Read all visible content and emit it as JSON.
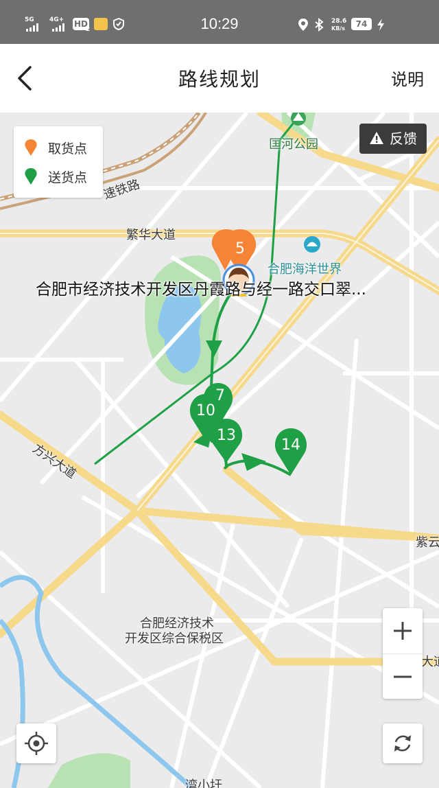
{
  "status_bar": {
    "network1": "5G",
    "network2": "4G+",
    "hd": "HD",
    "hd_sub": "2",
    "time": "10:29",
    "speed_value": "28.6",
    "speed_unit": "KB/s",
    "battery": "74"
  },
  "header": {
    "title": "路线规划",
    "help_label": "说明",
    "back_icon": "chevron-left-icon"
  },
  "map": {
    "legend": [
      {
        "label": "取货点",
        "color": "#F58434"
      },
      {
        "label": "送货点",
        "color": "#1FA046"
      }
    ],
    "feedback_label": "反馈",
    "address_label": "合肥市经济技术开发区丹霞路与经一路交口翠...",
    "labels": {
      "kuanghe_park": "匡河公园",
      "sutie_road": "速铁路",
      "fanhua_avenue": "繁华大道",
      "ocean_world": "合肥海洋世界",
      "fangxing_avenue": "方兴大道",
      "ziyun": "紫云",
      "bonded_zone_line1": "合肥经济技术",
      "bonded_zone_line2": "开发区综合保税区",
      "da_dao": "大道",
      "bottom_place": "湾小圩"
    },
    "pins": {
      "pickup": "5",
      "delivery_a": "10",
      "delivery_b": "7",
      "delivery_c": "13",
      "delivery_d": "14"
    },
    "colors": {
      "route": "#1FA046",
      "pickup": "#F58434",
      "delivery": "#1FA046",
      "major_road": "#F7D98B",
      "water": "#8EC7EE",
      "park": "#B8E2B4"
    }
  }
}
